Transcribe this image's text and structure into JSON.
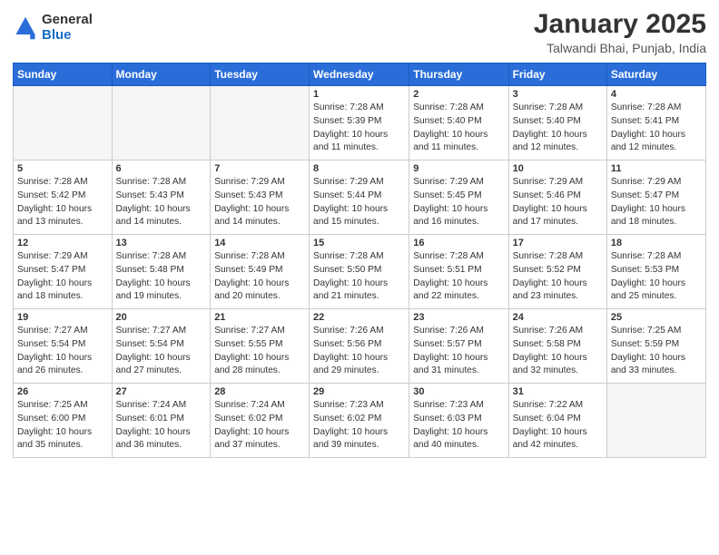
{
  "header": {
    "logo_general": "General",
    "logo_blue": "Blue",
    "month_title": "January 2025",
    "location": "Talwandi Bhai, Punjab, India"
  },
  "days_of_week": [
    "Sunday",
    "Monday",
    "Tuesday",
    "Wednesday",
    "Thursday",
    "Friday",
    "Saturday"
  ],
  "weeks": [
    [
      {
        "day": "",
        "info": ""
      },
      {
        "day": "",
        "info": ""
      },
      {
        "day": "",
        "info": ""
      },
      {
        "day": "1",
        "info": "Sunrise: 7:28 AM\nSunset: 5:39 PM\nDaylight: 10 hours\nand 11 minutes."
      },
      {
        "day": "2",
        "info": "Sunrise: 7:28 AM\nSunset: 5:40 PM\nDaylight: 10 hours\nand 11 minutes."
      },
      {
        "day": "3",
        "info": "Sunrise: 7:28 AM\nSunset: 5:40 PM\nDaylight: 10 hours\nand 12 minutes."
      },
      {
        "day": "4",
        "info": "Sunrise: 7:28 AM\nSunset: 5:41 PM\nDaylight: 10 hours\nand 12 minutes."
      }
    ],
    [
      {
        "day": "5",
        "info": "Sunrise: 7:28 AM\nSunset: 5:42 PM\nDaylight: 10 hours\nand 13 minutes."
      },
      {
        "day": "6",
        "info": "Sunrise: 7:28 AM\nSunset: 5:43 PM\nDaylight: 10 hours\nand 14 minutes."
      },
      {
        "day": "7",
        "info": "Sunrise: 7:29 AM\nSunset: 5:43 PM\nDaylight: 10 hours\nand 14 minutes."
      },
      {
        "day": "8",
        "info": "Sunrise: 7:29 AM\nSunset: 5:44 PM\nDaylight: 10 hours\nand 15 minutes."
      },
      {
        "day": "9",
        "info": "Sunrise: 7:29 AM\nSunset: 5:45 PM\nDaylight: 10 hours\nand 16 minutes."
      },
      {
        "day": "10",
        "info": "Sunrise: 7:29 AM\nSunset: 5:46 PM\nDaylight: 10 hours\nand 17 minutes."
      },
      {
        "day": "11",
        "info": "Sunrise: 7:29 AM\nSunset: 5:47 PM\nDaylight: 10 hours\nand 18 minutes."
      }
    ],
    [
      {
        "day": "12",
        "info": "Sunrise: 7:29 AM\nSunset: 5:47 PM\nDaylight: 10 hours\nand 18 minutes."
      },
      {
        "day": "13",
        "info": "Sunrise: 7:28 AM\nSunset: 5:48 PM\nDaylight: 10 hours\nand 19 minutes."
      },
      {
        "day": "14",
        "info": "Sunrise: 7:28 AM\nSunset: 5:49 PM\nDaylight: 10 hours\nand 20 minutes."
      },
      {
        "day": "15",
        "info": "Sunrise: 7:28 AM\nSunset: 5:50 PM\nDaylight: 10 hours\nand 21 minutes."
      },
      {
        "day": "16",
        "info": "Sunrise: 7:28 AM\nSunset: 5:51 PM\nDaylight: 10 hours\nand 22 minutes."
      },
      {
        "day": "17",
        "info": "Sunrise: 7:28 AM\nSunset: 5:52 PM\nDaylight: 10 hours\nand 23 minutes."
      },
      {
        "day": "18",
        "info": "Sunrise: 7:28 AM\nSunset: 5:53 PM\nDaylight: 10 hours\nand 25 minutes."
      }
    ],
    [
      {
        "day": "19",
        "info": "Sunrise: 7:27 AM\nSunset: 5:54 PM\nDaylight: 10 hours\nand 26 minutes."
      },
      {
        "day": "20",
        "info": "Sunrise: 7:27 AM\nSunset: 5:54 PM\nDaylight: 10 hours\nand 27 minutes."
      },
      {
        "day": "21",
        "info": "Sunrise: 7:27 AM\nSunset: 5:55 PM\nDaylight: 10 hours\nand 28 minutes."
      },
      {
        "day": "22",
        "info": "Sunrise: 7:26 AM\nSunset: 5:56 PM\nDaylight: 10 hours\nand 29 minutes."
      },
      {
        "day": "23",
        "info": "Sunrise: 7:26 AM\nSunset: 5:57 PM\nDaylight: 10 hours\nand 31 minutes."
      },
      {
        "day": "24",
        "info": "Sunrise: 7:26 AM\nSunset: 5:58 PM\nDaylight: 10 hours\nand 32 minutes."
      },
      {
        "day": "25",
        "info": "Sunrise: 7:25 AM\nSunset: 5:59 PM\nDaylight: 10 hours\nand 33 minutes."
      }
    ],
    [
      {
        "day": "26",
        "info": "Sunrise: 7:25 AM\nSunset: 6:00 PM\nDaylight: 10 hours\nand 35 minutes."
      },
      {
        "day": "27",
        "info": "Sunrise: 7:24 AM\nSunset: 6:01 PM\nDaylight: 10 hours\nand 36 minutes."
      },
      {
        "day": "28",
        "info": "Sunrise: 7:24 AM\nSunset: 6:02 PM\nDaylight: 10 hours\nand 37 minutes."
      },
      {
        "day": "29",
        "info": "Sunrise: 7:23 AM\nSunset: 6:02 PM\nDaylight: 10 hours\nand 39 minutes."
      },
      {
        "day": "30",
        "info": "Sunrise: 7:23 AM\nSunset: 6:03 PM\nDaylight: 10 hours\nand 40 minutes."
      },
      {
        "day": "31",
        "info": "Sunrise: 7:22 AM\nSunset: 6:04 PM\nDaylight: 10 hours\nand 42 minutes."
      },
      {
        "day": "",
        "info": ""
      }
    ]
  ]
}
